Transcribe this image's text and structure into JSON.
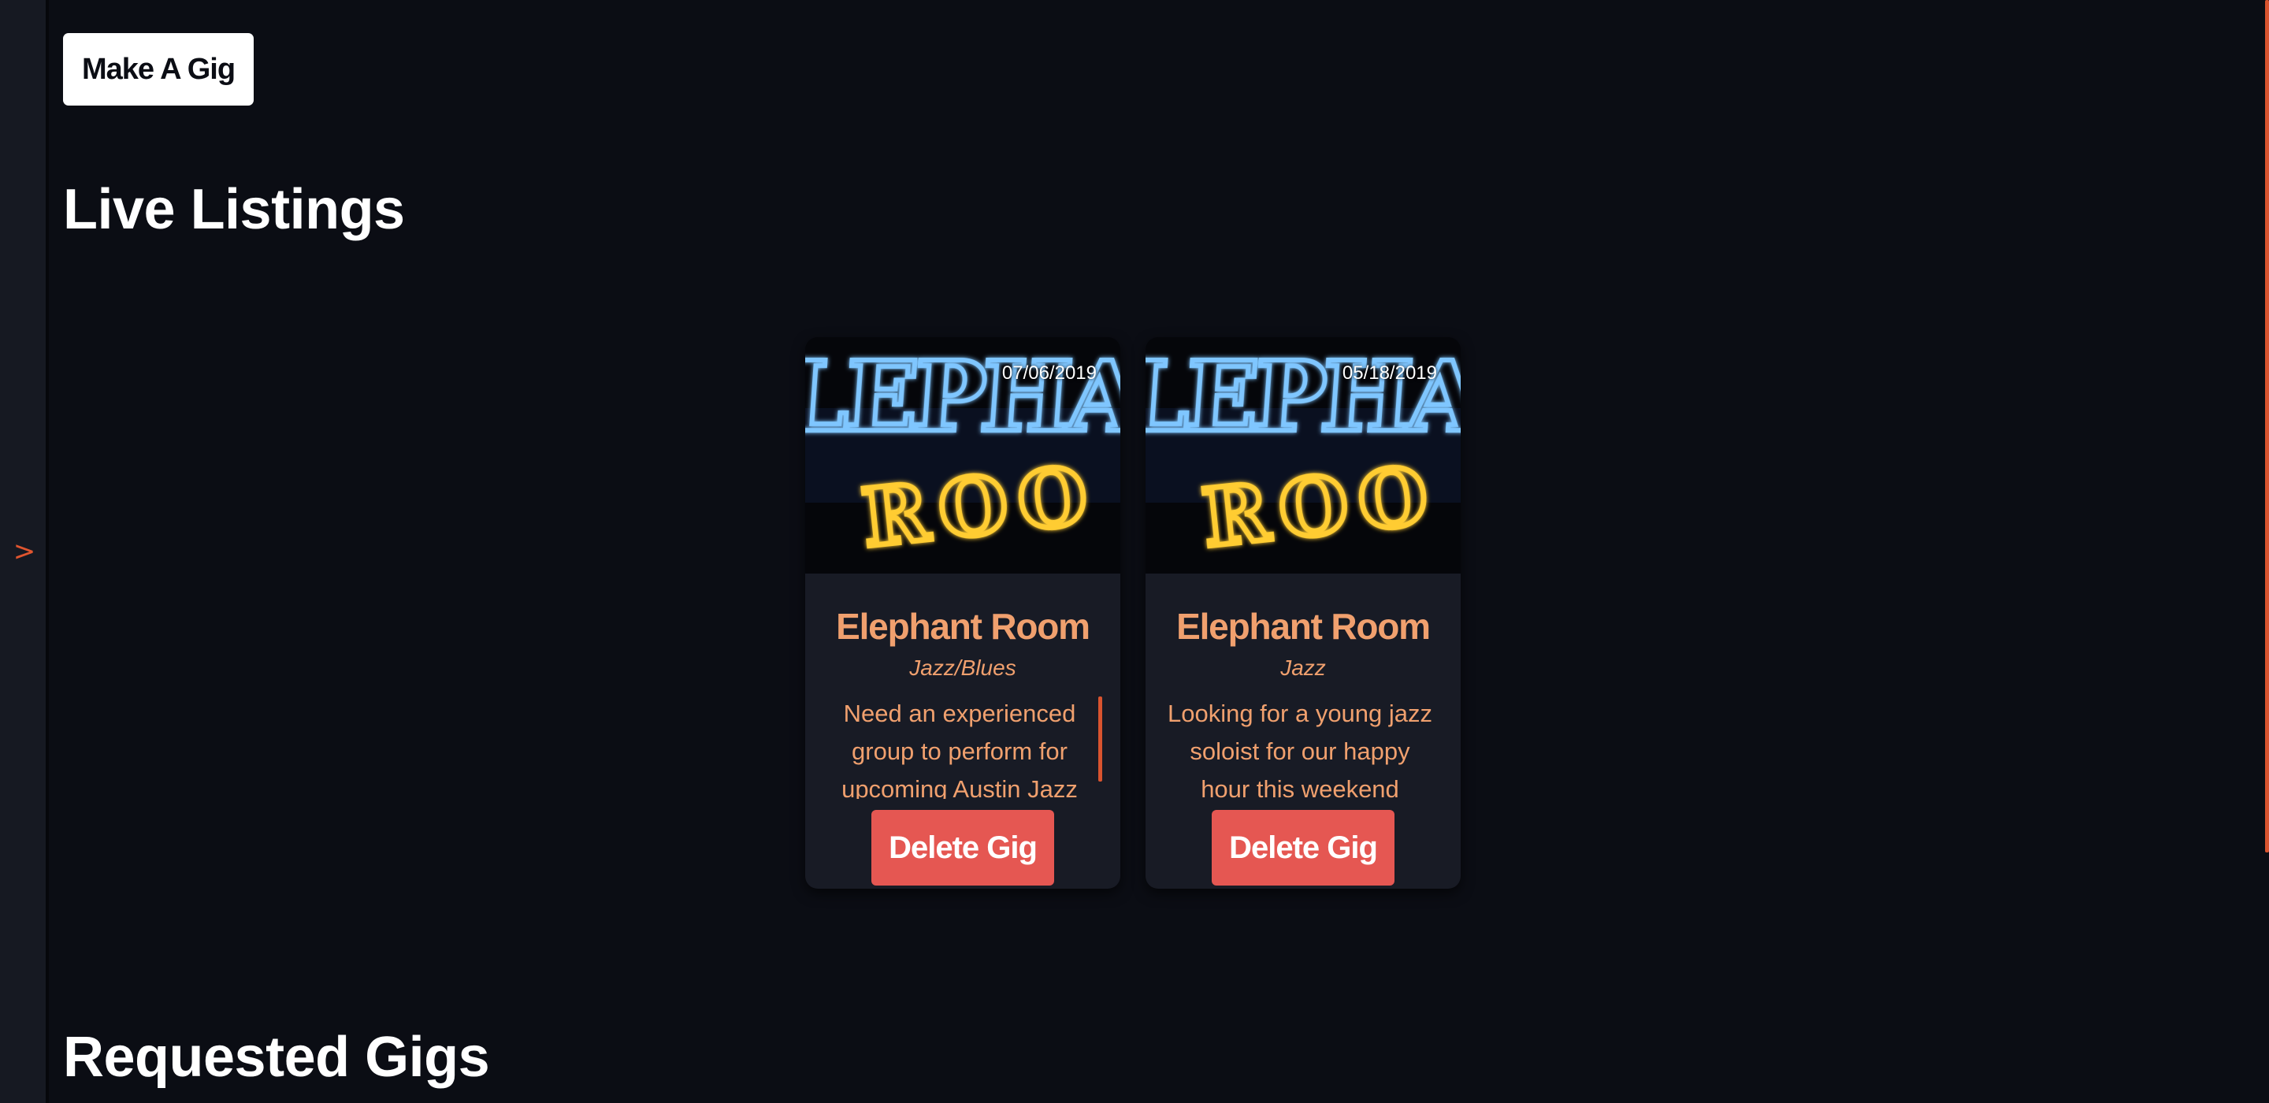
{
  "sidebar": {
    "toggle_glyph": ">",
    "toggle_icon": "chevron-right-icon"
  },
  "header": {
    "make_gig_label": "Make A Gig"
  },
  "sections": {
    "live_title": "Live Listings",
    "requested_title": "Requested Gigs"
  },
  "image_sign": {
    "line1": "LEPHA",
    "line2": "ROO"
  },
  "cards": [
    {
      "date": "07/06/2019",
      "title": "Elephant Room",
      "genre": "Jazz/Blues",
      "description": "Need an experienced group to perform for upcoming Austin Jazz",
      "delete_label": "Delete Gig"
    },
    {
      "date": "05/18/2019",
      "title": "Elephant Room",
      "genre": "Jazz",
      "description": "Looking for a young jazz soloist for our happy hour this weekend",
      "delete_label": "Delete Gig"
    }
  ],
  "colors": {
    "background": "#0b0d14",
    "card": "#181b25",
    "accent_text": "#f0a06e",
    "delete_button": "#e55752",
    "scroll_accent": "#d9542f"
  }
}
